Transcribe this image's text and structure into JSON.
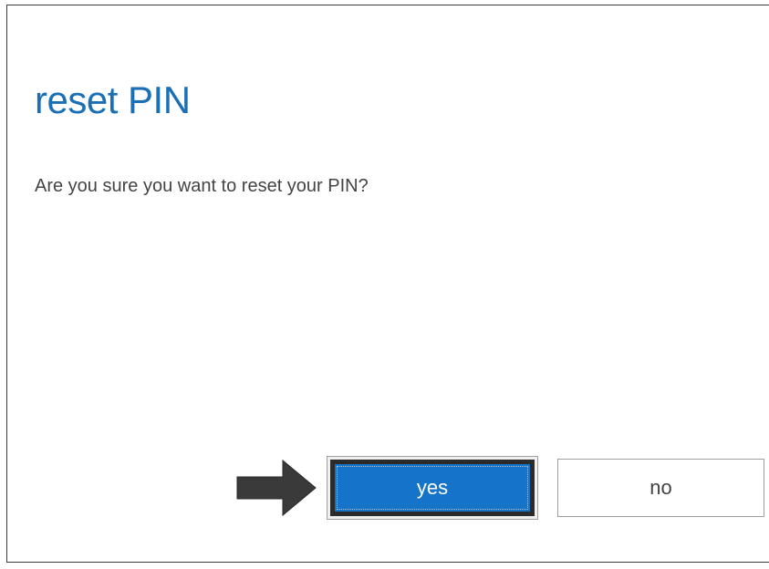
{
  "dialog": {
    "title": "reset PIN",
    "message": "Are you sure you want to reset your PIN?",
    "buttons": {
      "yes_label": "yes",
      "no_label": "no"
    },
    "colors": {
      "title": "#1b6fb5",
      "primary_button": "#1674c8",
      "arrow": "#3a3a3a"
    }
  },
  "annotation": {
    "icon": "right-arrow-icon"
  }
}
